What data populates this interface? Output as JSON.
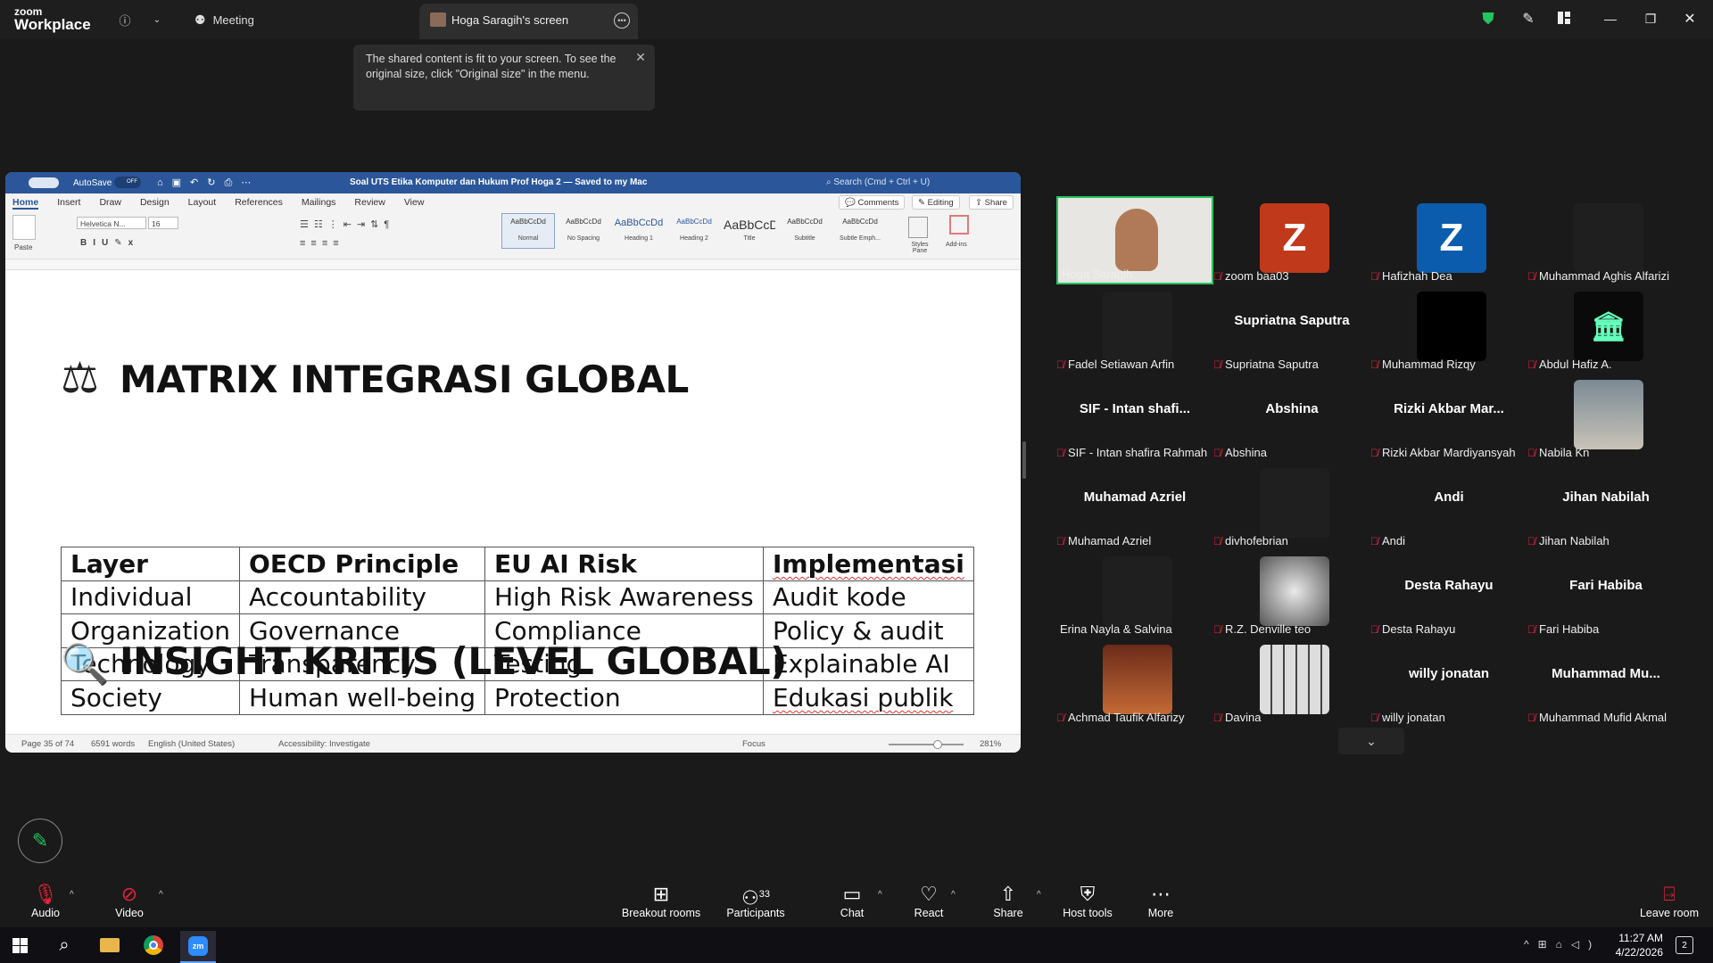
{
  "topbar": {
    "logo_top": "zoom",
    "logo_bottom": "Workplace",
    "meeting_label": "Meeting",
    "screen_tab_label": "Hoga Saragih's screen"
  },
  "tooltip": {
    "text": "The shared content is fit to your screen. To see the original size, click \"Original size\" in the menu."
  },
  "word": {
    "autosave_label": "AutoSave",
    "autosave_state": "OFF",
    "doc_title": "Soal UTS Etika Komputer dan Hukum Prof Hoga 2 — Saved to my Mac",
    "search_placeholder": "Search (Cmd + Ctrl + U)",
    "menu_tabs": [
      "Home",
      "Insert",
      "Draw",
      "Design",
      "Layout",
      "References",
      "Mailings",
      "Review",
      "View"
    ],
    "comments_label": "Comments",
    "editing_label": "Editing",
    "share_label": "Share",
    "font_name": "Helvetica N...",
    "font_size": "16",
    "paste_label": "Paste",
    "styles": [
      "Normal",
      "No Spacing",
      "Heading 1",
      "Heading 2",
      "Title",
      "Subtitle",
      "Subtle Emph..."
    ],
    "styles_pane_label": "Styles Pane",
    "addins_label": "Add-ins",
    "heading1": "MATRIX INTEGRASI GLOBAL",
    "heading2": "INSIGHT KRITIS (LEVEL GLOBAL)",
    "table": {
      "header": [
        "Layer",
        "OECD Principle",
        "EU AI Risk",
        "Implementasi"
      ],
      "rows": [
        [
          "Individual",
          "Accountability",
          "High Risk Awareness",
          "Audit kode"
        ],
        [
          "Organization",
          "Governance",
          "Compliance",
          "Policy & audit"
        ],
        [
          "Technology",
          "Transparency",
          "Testing",
          "Explainable AI"
        ],
        [
          "Society",
          "Human well-being",
          "Protection",
          "Edukasi publik"
        ]
      ]
    },
    "status": {
      "page": "Page 35 of 74",
      "words": "6591 words",
      "language": "English (United States)",
      "accessibility": "Accessibility: Investigate",
      "focus": "Focus",
      "zoom": "281%"
    }
  },
  "participants": [
    {
      "name": "Hoga Saragih",
      "type": "video"
    },
    {
      "name": "zoom baa03",
      "type": "letter",
      "letter": "Z",
      "color": "#c0391b"
    },
    {
      "name": "Hafizhah Dea",
      "type": "letter",
      "letter": "Z",
      "color": "#0b5cad"
    },
    {
      "name": "Muhammad Aghis Alfarizi",
      "type": "dark"
    },
    {
      "name": "Fadel Setiawan Arfin",
      "type": "dark"
    },
    {
      "name": "Supriatna Saputra",
      "type": "text",
      "display": "Supriatna Saputra"
    },
    {
      "name": "Muhammad Rizqy",
      "type": "black"
    },
    {
      "name": "Abdul Hafiz A.",
      "type": "pillars"
    },
    {
      "name": "SIF - Intan shafira Rahmah",
      "type": "text",
      "display": "SIF - Intan shafi..."
    },
    {
      "name": "Abshina",
      "type": "text",
      "display": "Abshina"
    },
    {
      "name": "Rizki Akbar Mardiyansyah",
      "type": "text",
      "display": "Rizki Akbar Mar..."
    },
    {
      "name": "Nabila Kn",
      "type": "photo"
    },
    {
      "name": "Muhamad Azriel",
      "type": "text",
      "display": "Muhamad Azriel"
    },
    {
      "name": "divhofebrian",
      "type": "dark"
    },
    {
      "name": "Andi",
      "type": "text",
      "display": "Andi"
    },
    {
      "name": "Jihan Nabilah",
      "type": "text",
      "display": "Jihan Nabilah"
    },
    {
      "name": "Erina Nayla & Salvina",
      "type": "dark",
      "muted": false
    },
    {
      "name": "R.Z. Denville teo",
      "type": "photo2"
    },
    {
      "name": "Desta Rahayu",
      "type": "text",
      "display": "Desta Rahayu"
    },
    {
      "name": "Fari Habiba",
      "type": "text",
      "display": "Fari Habiba"
    },
    {
      "name": "Achmad Taufik Alfarizy",
      "type": "photo3"
    },
    {
      "name": "Davina",
      "type": "collage"
    },
    {
      "name": "willy jonatan",
      "type": "text",
      "display": "willy jonatan"
    },
    {
      "name": "Muhammad Mufid Akmal",
      "type": "text",
      "display": "Muhammad  Mu..."
    }
  ],
  "toolbar": {
    "audio": "Audio",
    "video": "Video",
    "breakout": "Breakout rooms",
    "participants": "Participants",
    "participants_count": "33",
    "chat": "Chat",
    "react": "React",
    "share": "Share",
    "host_tools": "Host tools",
    "more": "More",
    "leave": "Leave room"
  },
  "taskbar": {
    "time": "11:27 AM",
    "date": "4/22/2026",
    "notifications": "2"
  },
  "colors": {
    "word_blue": "#2b579a",
    "zoom_green": "#22c55e",
    "muted_red": "#e2243a"
  }
}
